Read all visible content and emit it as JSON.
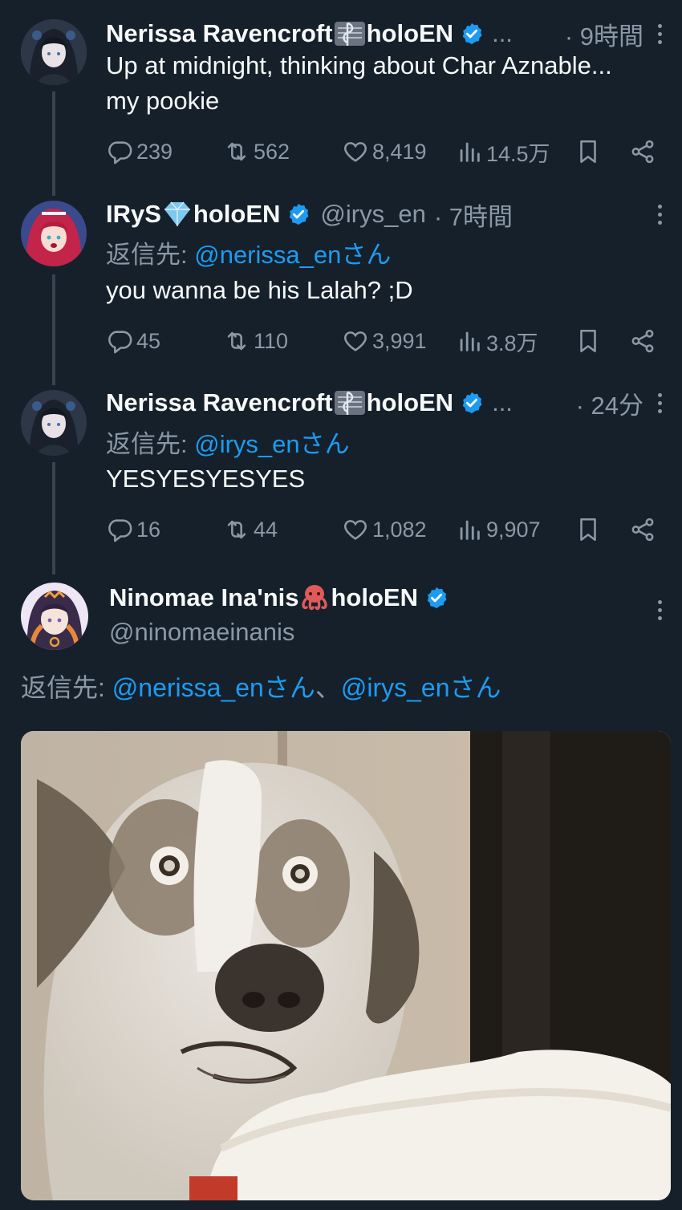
{
  "tweets": [
    {
      "name": "Nerissa Ravencroft",
      "name_suffix": "holoEN",
      "ellipsis": "...",
      "time": "· 9時間",
      "text_line1": "Up at midnight, thinking about Char Aznable...",
      "text_line2": "my pookie",
      "replies": "239",
      "retweets": "562",
      "likes": "8,419",
      "views": "14.5万"
    },
    {
      "name": "IRyS",
      "name_suffix": "holoEN",
      "handle": "@irys_en",
      "time": "· 7時間",
      "reply_prefix": "返信先: ",
      "reply_to": "@nerissa_enさん",
      "text_line1": "you wanna be his Lalah? ;D",
      "replies": "45",
      "retweets": "110",
      "likes": "3,991",
      "views": "3.8万"
    },
    {
      "name": "Nerissa Ravencroft",
      "name_suffix": "holoEN",
      "ellipsis": "...",
      "time": "· 24分",
      "reply_prefix": "返信先: ",
      "reply_to": "@irys_enさん",
      "text_line1": "YESYESYESYES",
      "replies": "16",
      "retweets": "44",
      "likes": "1,082",
      "views": "9,907"
    }
  ],
  "main": {
    "name": "Ninomae Ina'nis ",
    "name_suffix": "holoEN",
    "handle": "@ninomaeinanis",
    "reply_prefix": "返信先: ",
    "reply_to_1": "@nerissa_enさん",
    "reply_sep": "、",
    "reply_to_2": "@irys_enさん"
  },
  "colors": {
    "background": "#15202b",
    "accent": "#1d9bf0",
    "muted": "#8b98a5"
  }
}
